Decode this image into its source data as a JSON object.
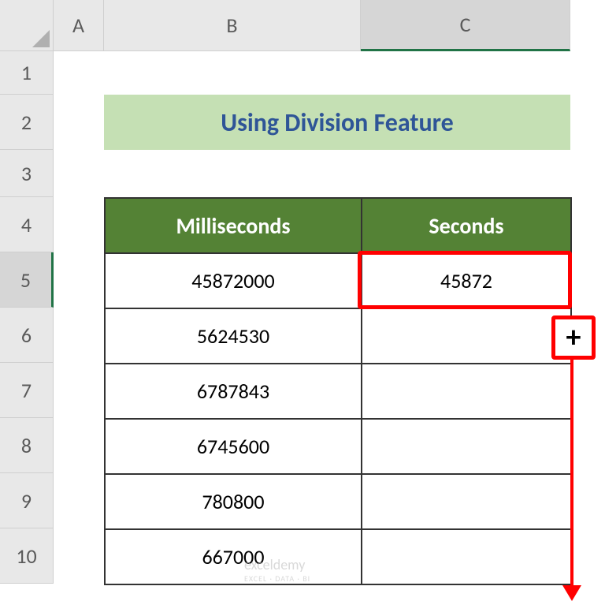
{
  "columns": {
    "a": "A",
    "b": "B",
    "c": "C"
  },
  "rows": {
    "r1": "1",
    "r2": "2",
    "r3": "3",
    "r4": "4",
    "r5": "5",
    "r6": "6",
    "r7": "7",
    "r8": "8",
    "r9": "9",
    "r10": "10"
  },
  "title": "Using Division Feature",
  "headers": {
    "milliseconds": "Milliseconds",
    "seconds": "Seconds"
  },
  "data": {
    "ms": [
      "45872000",
      "5624530",
      "6787843",
      "6745600",
      "780800",
      "667000"
    ],
    "sec": [
      "45872",
      "",
      "",
      "",
      "",
      ""
    ]
  },
  "fill_handle": "+",
  "watermark": {
    "main": "exceldemy",
    "sub": "EXCEL · DATA · BI"
  },
  "chart_data": {
    "type": "table",
    "title": "Using Division Feature",
    "columns": [
      "Milliseconds",
      "Seconds"
    ],
    "rows": [
      [
        "45872000",
        "45872"
      ],
      [
        "5624530",
        ""
      ],
      [
        "6787843",
        ""
      ],
      [
        "6745600",
        ""
      ],
      [
        "780800",
        ""
      ],
      [
        "667000",
        ""
      ]
    ]
  }
}
